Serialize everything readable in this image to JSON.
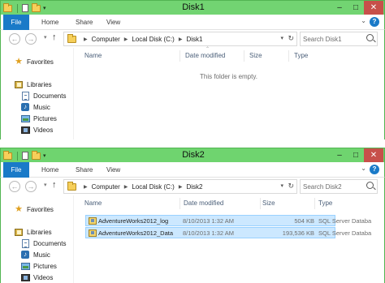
{
  "windows": [
    {
      "title": "Disk1",
      "ribbon": {
        "tabs": [
          "File",
          "Home",
          "Share",
          "View"
        ]
      },
      "address": {
        "crumbs": [
          "Computer",
          "Local Disk (C:)",
          "Disk1"
        ]
      },
      "search": {
        "placeholder": "Search Disk1"
      },
      "nav": {
        "favorites": "Favorites",
        "libraries": "Libraries",
        "items": [
          "Documents",
          "Music",
          "Pictures",
          "Videos"
        ]
      },
      "columns": [
        "Name",
        "Date modified",
        "Size",
        "Type"
      ],
      "empty_message": "This folder is empty.",
      "files": []
    },
    {
      "title": "Disk2",
      "ribbon": {
        "tabs": [
          "File",
          "Home",
          "Share",
          "View"
        ]
      },
      "address": {
        "crumbs": [
          "Computer",
          "Local Disk (C:)",
          "Disk2"
        ]
      },
      "search": {
        "placeholder": "Search Disk2"
      },
      "nav": {
        "favorites": "Favorites",
        "libraries": "Libraries",
        "items": [
          "Documents",
          "Music",
          "Pictures",
          "Videos"
        ]
      },
      "columns": [
        "Name",
        "Date modified",
        "Size",
        "Type"
      ],
      "empty_message": "",
      "files": [
        {
          "name": "AdventureWorks2012_log",
          "date": "8/10/2013 1:32 AM",
          "size": "504 KB",
          "type": "SQL Server Databa"
        },
        {
          "name": "AdventureWorks2012_Data",
          "date": "8/10/2013 1:32 AM",
          "size": "193,536 KB",
          "type": "SQL Server Databa"
        }
      ]
    }
  ],
  "colors": {
    "titlebar": "#72d472",
    "file_tab": "#1a7ac8",
    "close_button": "#c7504a",
    "selection": "#cce8ff",
    "selection_border": "#99d1ff"
  }
}
